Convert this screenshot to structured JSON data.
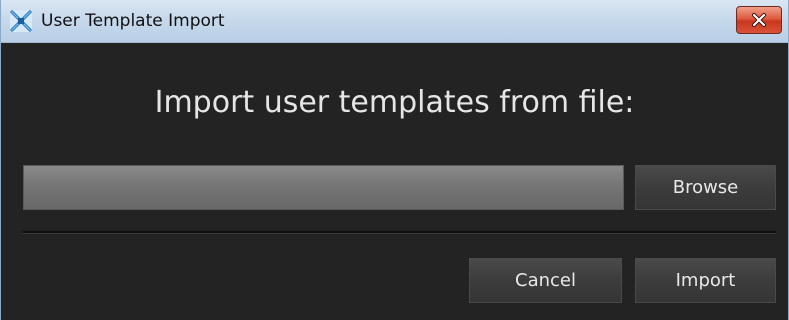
{
  "window": {
    "title": "User Template Import",
    "app_icon": "x-shaped-app-icon",
    "close_icon": "close-icon"
  },
  "dialog": {
    "heading": "Import user templates from file:",
    "file_path_value": "",
    "browse_label": "Browse",
    "cancel_label": "Cancel",
    "import_label": "Import"
  },
  "colors": {
    "background": "#232323",
    "heading_text": "#e6e6e6",
    "close_button": "#d9533a",
    "titlebar": "#c7d9ec"
  }
}
